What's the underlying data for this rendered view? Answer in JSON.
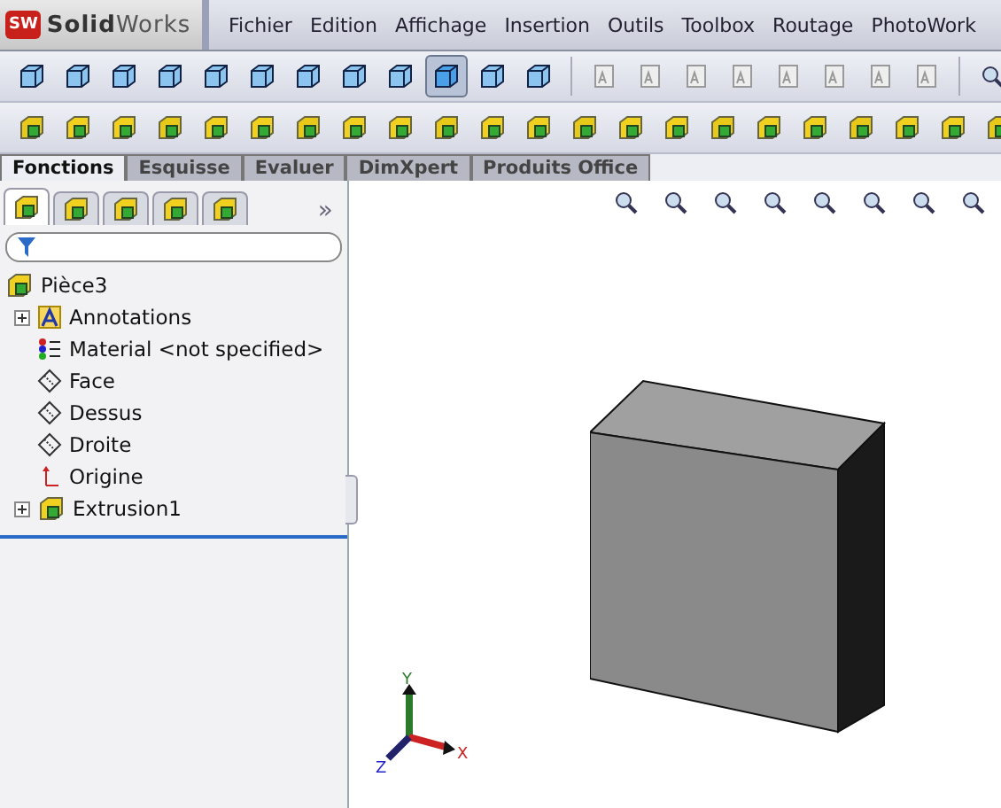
{
  "app": {
    "badge": "SW",
    "logo": "**Solid**Works"
  },
  "menu": [
    "Fichier",
    "Edition",
    "Affichage",
    "Insertion",
    "Outils",
    "Toolbox",
    "Routage",
    "PhotoWork"
  ],
  "view_toolbar": [
    {
      "selected": false
    },
    {
      "selected": false
    },
    {
      "selected": false
    },
    {
      "selected": false
    },
    {
      "selected": false
    },
    {
      "selected": false
    },
    {
      "selected": false
    },
    {
      "selected": false
    },
    {
      "selected": false
    },
    {
      "selected": true
    },
    {
      "selected": false
    },
    {
      "selected": false
    }
  ],
  "command_tabs": [
    {
      "label": "Fonctions",
      "selected": true
    },
    {
      "label": "Esquisse",
      "selected": false
    },
    {
      "label": "Evaluer",
      "selected": false
    },
    {
      "label": "DimXpert",
      "selected": false
    },
    {
      "label": "Produits Office",
      "selected": false
    }
  ],
  "panel_tabs": [
    {
      "selected": true
    },
    {
      "selected": false
    },
    {
      "selected": false
    },
    {
      "selected": false
    },
    {
      "selected": false
    }
  ],
  "panel_more": "»",
  "tree": {
    "label": "Pièce3",
    "children": [
      {
        "kind": "annotations",
        "label": "Annotations",
        "expanded": false
      },
      {
        "kind": "material",
        "label": "Material <not specified>"
      },
      {
        "kind": "plane",
        "label": "Face"
      },
      {
        "kind": "plane",
        "label": "Dessus"
      },
      {
        "kind": "plane",
        "label": "Droite"
      },
      {
        "kind": "origin",
        "label": "Origine"
      },
      {
        "kind": "feature",
        "label": "Extrusion1",
        "expanded": false
      }
    ]
  },
  "triad": {
    "y": "Y",
    "x": "X",
    "z": "Z"
  }
}
